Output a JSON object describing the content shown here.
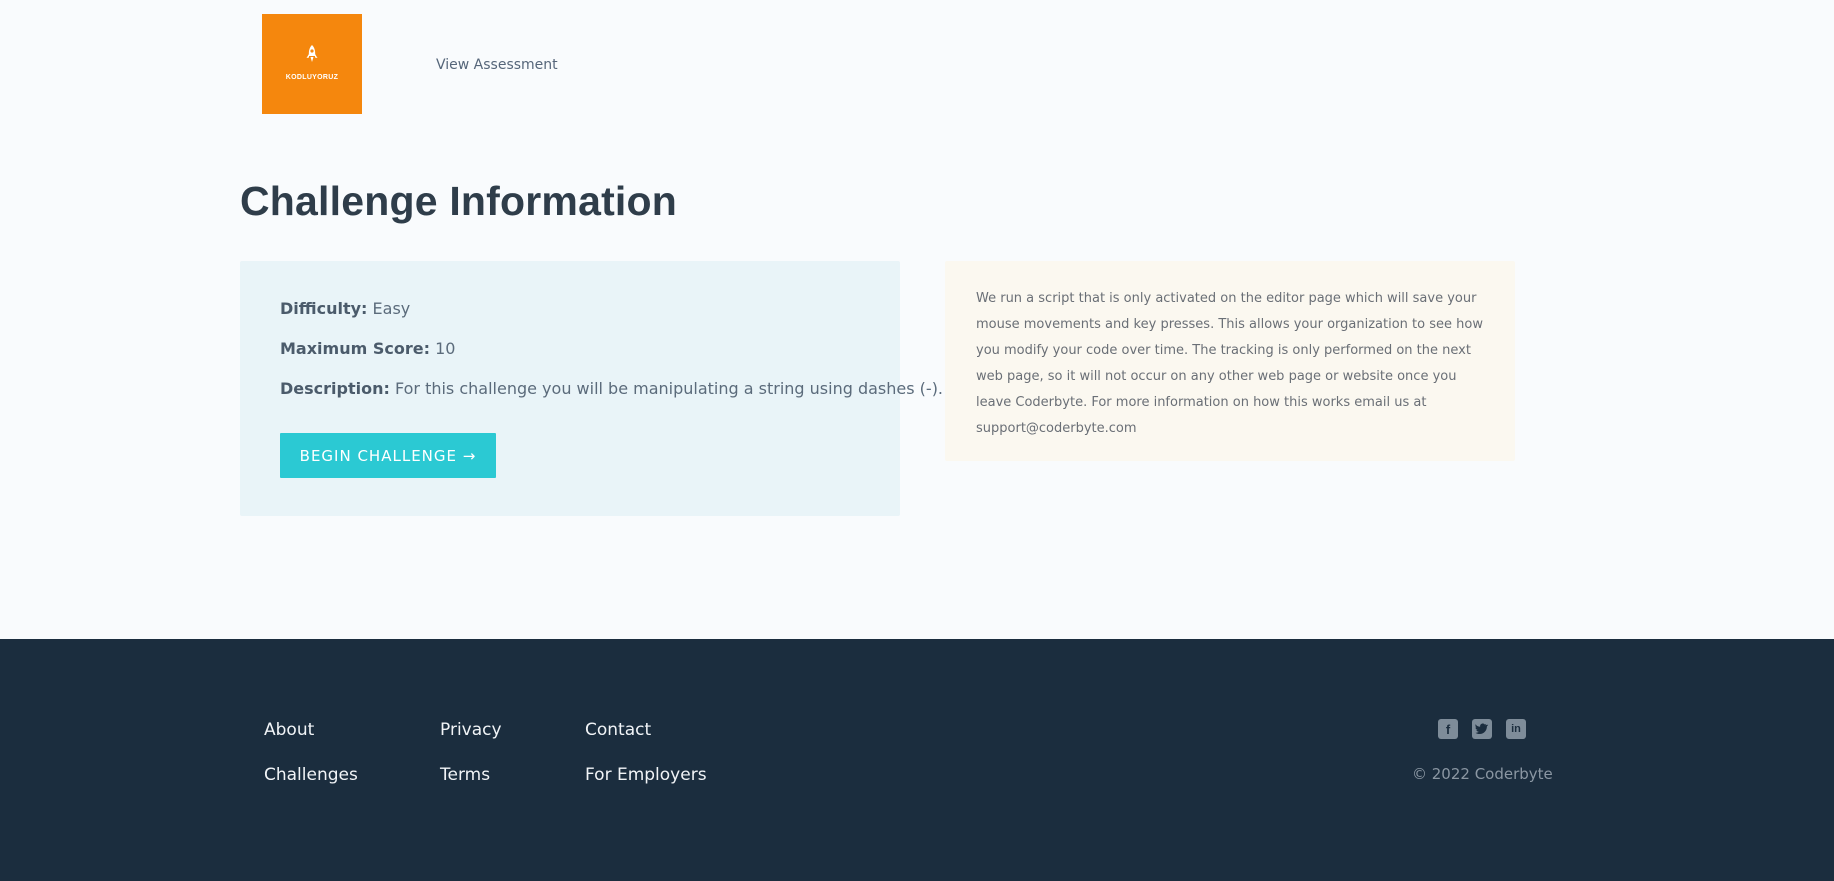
{
  "header": {
    "logo_text": "KODLUYORUZ",
    "nav_link": "View Assessment"
  },
  "main": {
    "title": "Challenge Information",
    "info": {
      "difficulty_label": "Difficulty:",
      "difficulty_value": "Easy",
      "max_score_label": "Maximum Score:",
      "max_score_value": "10",
      "description_label": "Description:",
      "description_value": "For this challenge you will be manipulating a string using dashes (-).",
      "begin_button": "BEGIN CHALLENGE →"
    },
    "notice": "We run a script that is only activated on the editor page which will save your mouse movements and key presses. This allows your organization to see how you modify your code over time. The tracking is only performed on the next web page, so it will not occur on any other web page or website once you leave Coderbyte. For more information on how this works email us at support@coderbyte.com"
  },
  "footer": {
    "links": {
      "about": "About",
      "challenges": "Challenges",
      "privacy": "Privacy",
      "terms": "Terms",
      "contact": "Contact",
      "employers": "For Employers"
    },
    "social": [
      "facebook-icon",
      "twitter-icon",
      "linkedin-icon"
    ],
    "copyright": "© 2022 Coderbyte"
  },
  "colors": {
    "accent": "#2bc9d3",
    "logo_bg": "#f5870d",
    "footer_bg": "#1b2d3e"
  }
}
